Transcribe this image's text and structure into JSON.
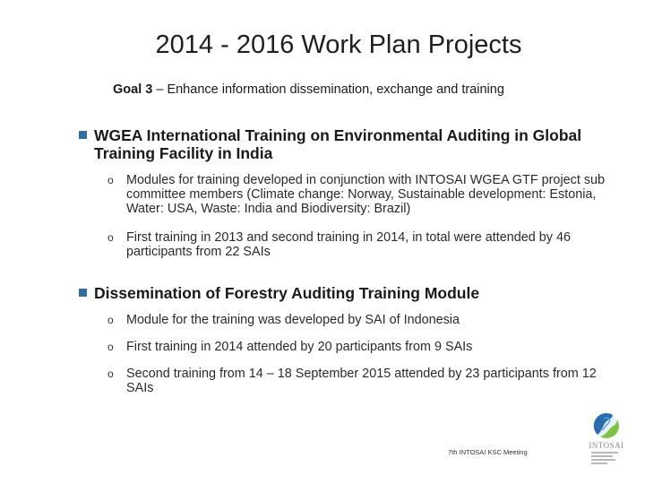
{
  "slide": {
    "title": "2014 - 2016 Work Plan Projects",
    "subtitle_goal": "Goal 3",
    "subtitle_rest": " – Enhance information dissemination, exchange and training",
    "sections": [
      {
        "heading": "WGEA  International Training on Environmental Auditing in Global Training Facility in India",
        "items": [
          "Modules for training developed in conjunction with INTOSAI WGEA GTF project sub committee members (Climate change: Norway, Sustainable development: Estonia, Water: USA, Waste: India and Biodiversity: Brazil)",
          "First training in 2013 and second training in 2014, in total were attended by 46 participants from 22 SAIs"
        ]
      },
      {
        "heading": "Dissemination of Forestry Auditing Training Module",
        "items": [
          "Module for the training was developed by SAI of Indonesia",
          "First training in 2014 attended by 20 participants from 9 SAIs",
          "Second training from 14 – 18 September 2015 attended by 23 participants from 12 SAIs"
        ]
      }
    ],
    "bullet_glyph": "o",
    "footer": "7th INTOSAI KSC Meeting",
    "logo_text": "INTOSAI",
    "logo_icon": "intosai-globe-logo",
    "colors": {
      "square_bullet": "#2f6ea3",
      "logo_blue": "#2b6cb0",
      "logo_green": "#7cc242"
    }
  }
}
